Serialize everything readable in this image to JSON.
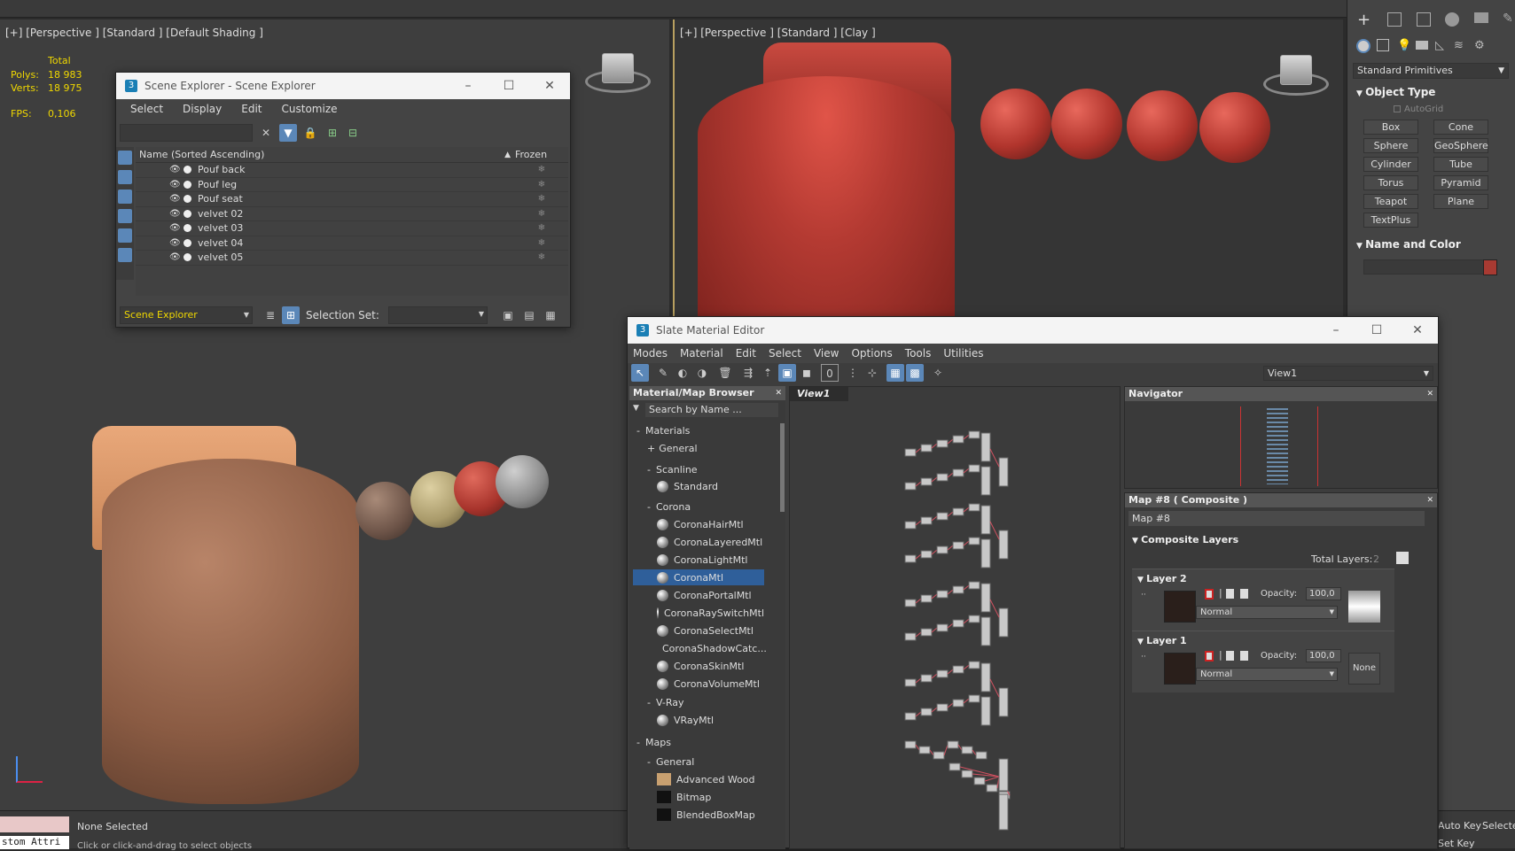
{
  "viewport_top_left": {
    "label": "[+] [Perspective ] [Standard ] [Default Shading ]",
    "stats": {
      "total": "Total",
      "polys_label": "Polys:",
      "polys": "18 983",
      "verts_label": "Verts:",
      "verts": "18 975",
      "fps_label": "FPS:",
      "fps": "0,106"
    }
  },
  "viewport_top_right": {
    "label": "[+] [Perspective ] [Standard ] [Clay ]"
  },
  "status": {
    "none_selected": "None Selected",
    "custom_attr": "stom Attri",
    "hint": "Click or click-and-drag to select objects",
    "auto_key": "Auto Key",
    "selected": "Selecte",
    "set_key": "Set Key"
  },
  "scene_explorer": {
    "title": "Scene Explorer - Scene Explorer",
    "menu": [
      "Select",
      "Display",
      "Edit",
      "Customize"
    ],
    "col_name": "Name (Sorted Ascending)",
    "col_frozen": "Frozen",
    "rows": [
      "Pouf back",
      "Pouf leg",
      "Pouf seat",
      "velvet 02",
      "velvet 03",
      "velvet 04",
      "velvet 05"
    ],
    "explorer_name": "Scene Explorer",
    "selection_set_label": "Selection Set:"
  },
  "command_panel": {
    "dropdown": "Standard Primitives",
    "object_type": "Object Type",
    "autogrid": "AutoGrid",
    "buttons": [
      "Box",
      "Cone",
      "Sphere",
      "GeoSphere",
      "Cylinder",
      "Tube",
      "Torus",
      "Pyramid",
      "Teapot",
      "Plane",
      "TextPlus"
    ],
    "name_and_color": "Name and Color",
    "object_color": "#a83a32"
  },
  "slate": {
    "title": "Slate Material Editor",
    "menu": [
      "Modes",
      "Material",
      "Edit",
      "Select",
      "View",
      "Options",
      "Tools",
      "Utilities"
    ],
    "view_dropdown": "View1",
    "browser_title": "Material/Map Browser",
    "search_placeholder": "Search by Name ...",
    "view_tab": "View1",
    "navigator": "Navigator",
    "groups": {
      "materials": "Materials",
      "general": "General",
      "scanline": "Scanline",
      "standard": "Standard",
      "corona": "Corona",
      "vray": "V-Ray",
      "vraymtl": "VRayMtl",
      "maps": "Maps",
      "maps_general": "General"
    },
    "corona_items": [
      "CoronaHairMtl",
      "CoronaLayeredMtl",
      "CoronaLightMtl",
      "CoronaMtl",
      "CoronaPortalMtl",
      "CoronaRaySwitchMtl",
      "CoronaSelectMtl",
      "CoronaShadowCatc...",
      "CoronaSkinMtl",
      "CoronaVolumeMtl"
    ],
    "map_items": [
      "Advanced Wood",
      "Bitmap",
      "BlendedBoxMap"
    ],
    "param_title": "Map #8 ( Composite )",
    "map_name": "Map #8",
    "composite_layers": "Composite Layers",
    "total_layers_label": "Total Layers:",
    "total_layers": "2",
    "layer2": "Layer 2",
    "layer1": "Layer 1",
    "opacity_label": "Opacity:",
    "opacity2": "100,0",
    "opacity1": "100,0",
    "blend2": "Normal",
    "blend1": "Normal",
    "none_label": "None"
  }
}
